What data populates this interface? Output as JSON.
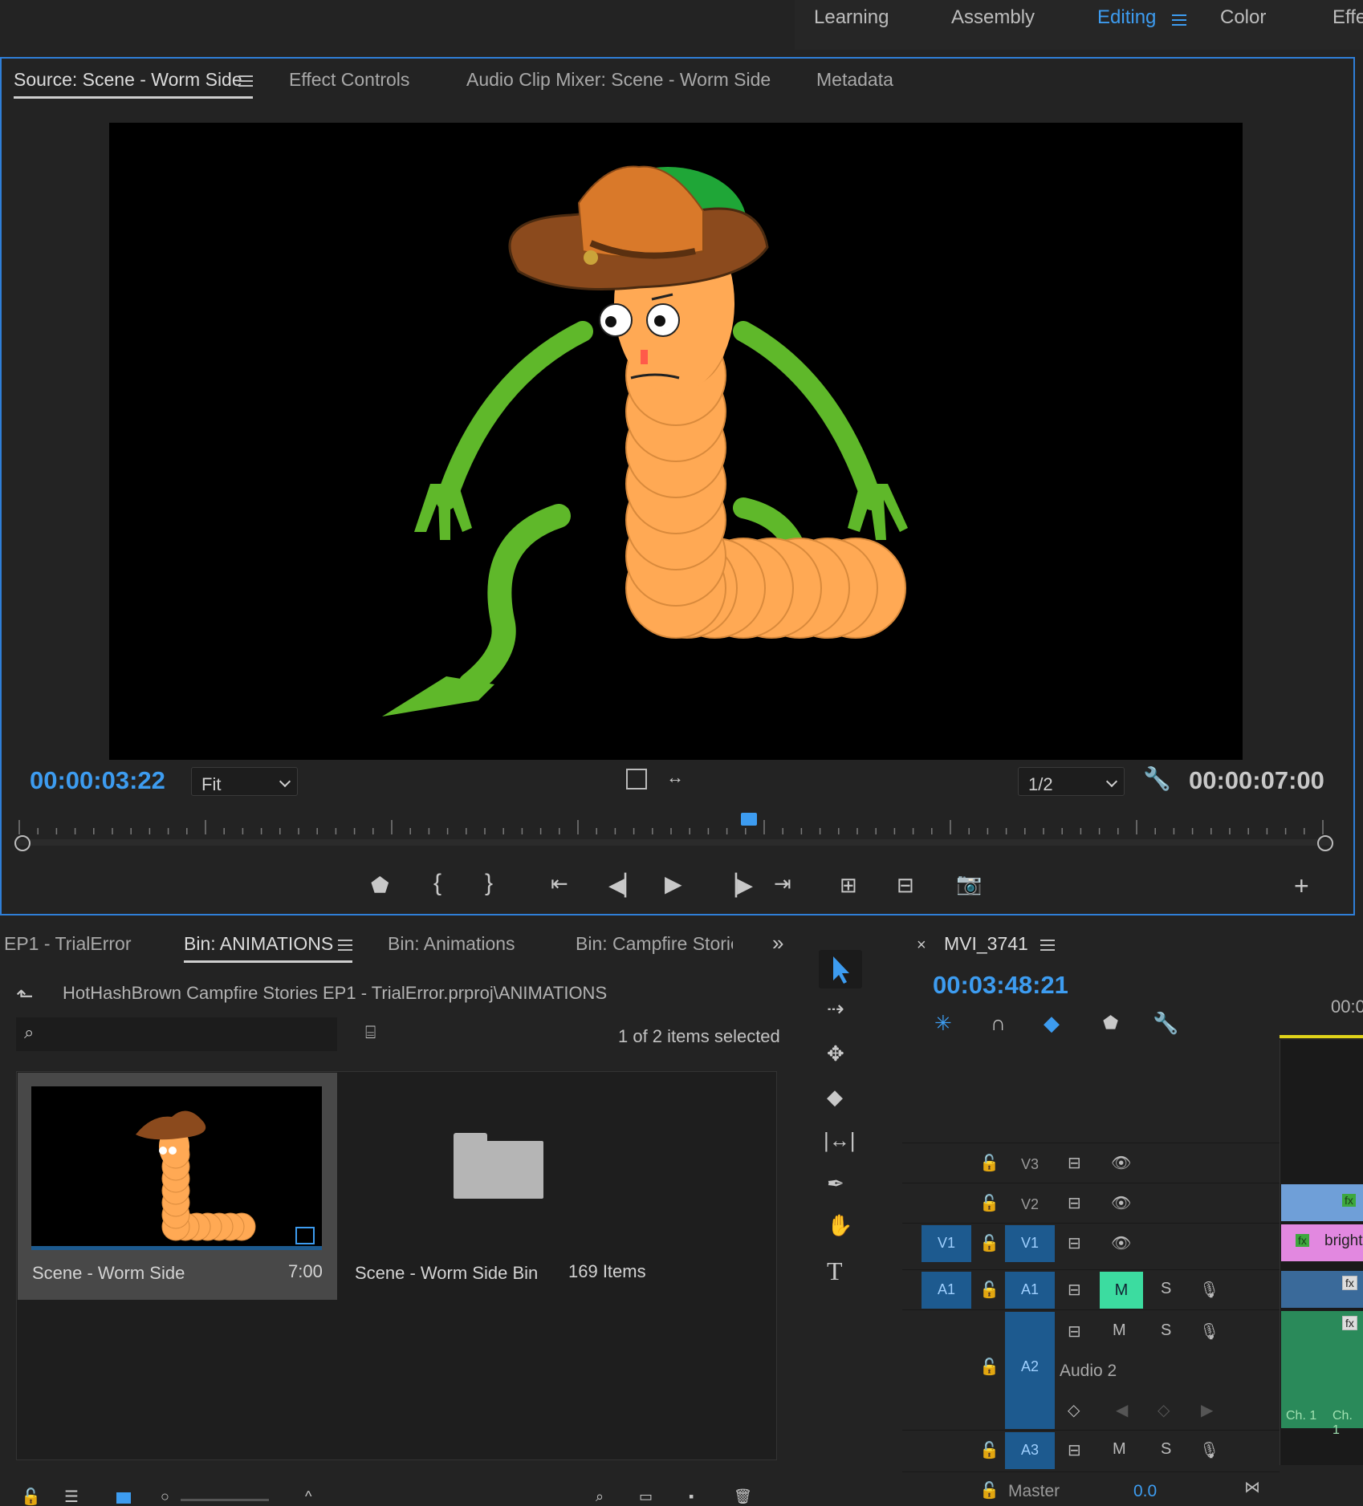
{
  "workspace": {
    "tabs": [
      "Learning",
      "Assembly",
      "Editing",
      "Color",
      "Effe"
    ],
    "active": "Editing",
    "accent": "#3d9cf0"
  },
  "source_panel": {
    "tabs": [
      "Source: Scene - Worm Side",
      "Effect Controls",
      "Audio Clip Mixer: Scene - Worm Side",
      "Metadata"
    ],
    "playhead_timecode": "00:00:03:22",
    "zoom_select": "Fit",
    "resolution_select": "1/2",
    "duration_timecode": "00:00:07:00",
    "playhead_position_fraction": 0.56,
    "transport": [
      "add-marker",
      "mark-in",
      "mark-out",
      "go-to-in",
      "step-back",
      "play",
      "step-forward",
      "go-to-out",
      "insert",
      "overwrite",
      "export-frame"
    ]
  },
  "project_panel": {
    "tabs": [
      "EP1 - TrialError",
      "Bin: ANIMATIONS",
      "Bin: Animations",
      "Bin: Campfire Storie"
    ],
    "active_tab": "Bin: ANIMATIONS",
    "path": "HotHashBrown Campfire Stories EP1 - TrialError.prproj\\ANIMATIONS",
    "selection_status": "1 of 2 items selected",
    "search_placeholder": "",
    "items": [
      {
        "name": "Scene - Worm Side",
        "meta": "7:00",
        "selected": true
      },
      {
        "name": "Scene - Worm Side Bin",
        "meta": "169 Items",
        "selected": false
      }
    ]
  },
  "timeline": {
    "sequence_name": "MVI_3741",
    "timecode": "00:03:48:21",
    "ruler_label": "00:0",
    "tracks": [
      {
        "id": "V3",
        "src": "",
        "label": "V3"
      },
      {
        "id": "V2",
        "src": "",
        "label": "V2"
      },
      {
        "id": "V1",
        "src": "V1",
        "label": "V1",
        "clip_label": "bright"
      },
      {
        "id": "A1",
        "src": "A1",
        "label": "A1",
        "mute": "M",
        "solo": "S"
      },
      {
        "id": "A2",
        "src": "",
        "label": "A2",
        "name": "Audio 2",
        "mute": "M",
        "solo": "S",
        "channel_labels": [
          "Ch. 1",
          "Ch. 1"
        ]
      },
      {
        "id": "A3",
        "src": "",
        "label": "A3",
        "mute": "M",
        "solo": "S"
      }
    ],
    "master_label": "Master",
    "master_value": "0.0"
  }
}
